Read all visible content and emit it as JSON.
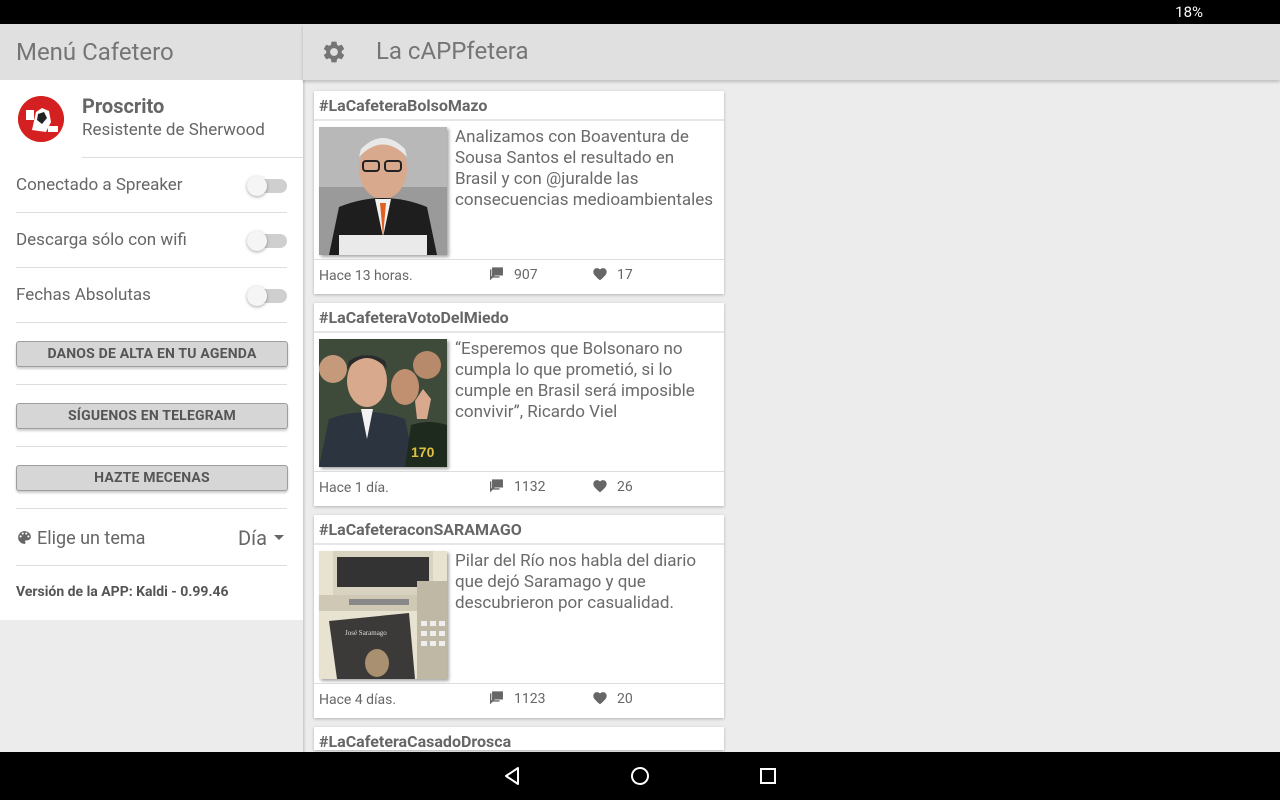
{
  "status": {
    "battery": "18%"
  },
  "drawer": {
    "title": "Menú Cafetero",
    "profile": {
      "name": "Proscrito",
      "subtitle": "Resistente de Sherwood"
    },
    "settings": [
      {
        "label": "Conectado a Spreaker",
        "on": false
      },
      {
        "label": "Descarga sólo con wifi",
        "on": false
      },
      {
        "label": "Fechas Absolutas",
        "on": false
      }
    ],
    "buttons": [
      {
        "label": "DANOS DE ALTA EN TU AGENDA"
      },
      {
        "label": "SÍGUENOS EN TELEGRAM"
      },
      {
        "label": "HAZTE MECENAS"
      }
    ],
    "theme": {
      "label": "Elige un tema",
      "value": "Día"
    },
    "version": "Versión de la APP: Kaldi - 0.99.46"
  },
  "appbar": {
    "title": "La cAPPfetera"
  },
  "feed": [
    {
      "tag": "#LaCafeteraBolsoMazo",
      "text": "Analizamos con Boaventura de Sousa Santos el resultado en Brasil y con @juralde las consecuencias medioambientales",
      "time": "Hace 13 horas.",
      "comments": "907",
      "likes": "17"
    },
    {
      "tag": "#LaCafeteraVotoDelMiedo",
      "text": "“Esperemos que Bolsonaro no cumpla lo que prometió, si lo cumple en Brasil será imposible convivir”, Ricardo Viel",
      "time": "Hace 1 día.",
      "comments": "1132",
      "likes": "26"
    },
    {
      "tag": "#LaCafeteraconSARAMAGO",
      "text": "Pilar del Río nos habla del diario que dejó Saramago y que descubrieron por casualidad.",
      "time": "Hace 4 días.",
      "comments": "1123",
      "likes": "20"
    },
    {
      "tag": "#LaCafeteraCasadoDrosca"
    }
  ]
}
